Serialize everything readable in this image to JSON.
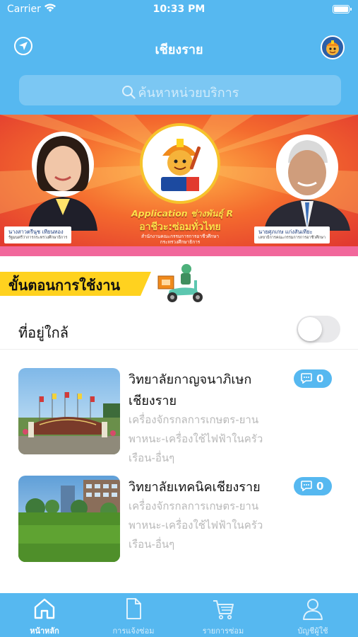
{
  "status_bar": {
    "carrier": "Carrier",
    "time": "10:33 PM"
  },
  "header": {
    "title": "เชียงราย",
    "search_placeholder": "ค้นหาหน่วยบริการ"
  },
  "banner": {
    "left_person": {
      "name": "นางสาวตรีนุช เทียนทอง",
      "position": "รัฐมนตรีว่าการกระทรวงศึกษาธิการ"
    },
    "right_person": {
      "name": "นายศุภเกษ แก่งสันเทียะ",
      "position": "เลขาธิการคณะกรรมการการอาชีวศึกษา"
    },
    "app_line": "Application ช่างพันธุ์ R",
    "app_tagline": "อาชีวะ:ซ่อมทั่วไทย",
    "agency_line1": "สำนักงานคณะกรรมการการอาชีวศึกษา",
    "agency_line2": "กระทรวงศึกษาธิการ"
  },
  "steps": {
    "label": "ขั้นตอนการใช้งาน"
  },
  "nearby": {
    "label": "ที่อยู่ใกล้",
    "enabled": false
  },
  "services": [
    {
      "title": "วิทยาลัยกาญจนาภิเษกเชียงราย",
      "description": "เครื่องจักรกลการเกษตร-ยานพาหนะ-เครื่องใช้ไฟฟ้าในครัวเรือน-อื่นๆ",
      "count": "0"
    },
    {
      "title": "วิทยาลัยเทคนิคเชียงราย",
      "description": "เครื่องจักรกลการเกษตร-ยานพาหนะ-เครื่องใช้ไฟฟ้าในครัวเรือน-อื่นๆ",
      "count": "0"
    }
  ],
  "tabbar": {
    "tabs": [
      {
        "label": "หน้าหลัก",
        "icon": "home-icon",
        "active": true
      },
      {
        "label": "การแจ้งซ่อม",
        "icon": "document-icon",
        "active": false
      },
      {
        "label": "รายการซ่อม",
        "icon": "cart-icon",
        "active": false
      },
      {
        "label": "บัญชีผู้ใช้",
        "icon": "user-icon",
        "active": false
      }
    ]
  },
  "colors": {
    "primary": "#56b8f0",
    "accent_yellow": "#ffd21f",
    "banner_orange": "#f04d2c"
  }
}
